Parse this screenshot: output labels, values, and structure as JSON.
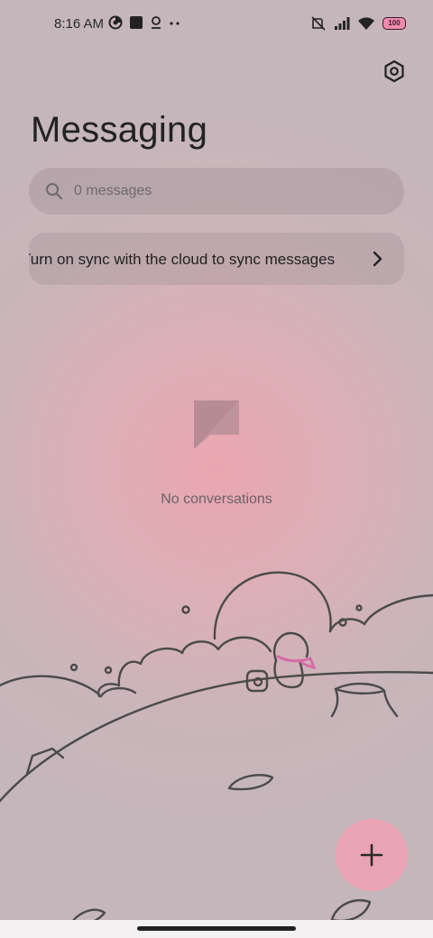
{
  "status_bar": {
    "time": "8:16 AM",
    "battery": "100",
    "left_icons": [
      "data-saver-icon",
      "square-app-icon",
      "location-pin-icon",
      "more-dots-icon"
    ],
    "right_icons": [
      "mute-vibrate-icon",
      "signal-icon",
      "wifi-icon",
      "battery-icon"
    ]
  },
  "header": {
    "title": "Messaging",
    "settings_icon": "settings-hexagon-icon"
  },
  "search": {
    "placeholder": "0 messages"
  },
  "sync_banner": {
    "text": "Turn on sync with the cloud to sync messages"
  },
  "empty_state": {
    "icon": "chat-bubble-icon",
    "text": "No conversations"
  },
  "fab": {
    "icon": "plus-icon"
  },
  "colors": {
    "accent": "#eaa3b4",
    "background": "#c6b5ba"
  }
}
